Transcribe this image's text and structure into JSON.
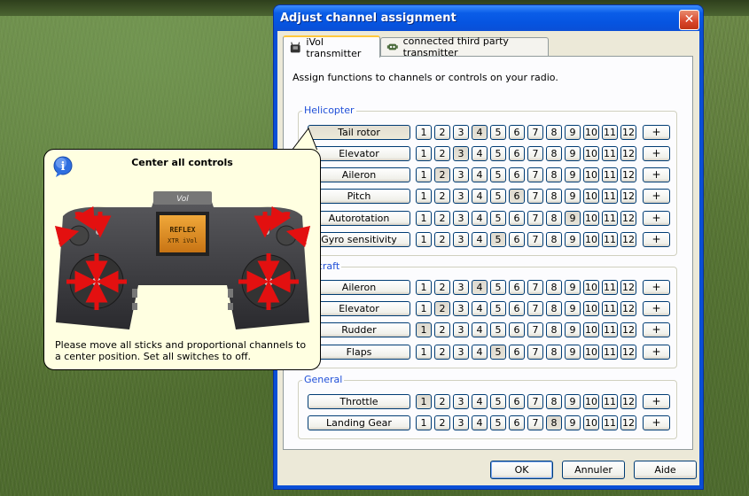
{
  "dialog": {
    "title": "Adjust channel assignment",
    "close_label": "✕",
    "tabs": [
      {
        "label": "iVol transmitter",
        "icon": "transmitter-icon"
      },
      {
        "label": "connected third party transmitter",
        "icon": "robot-icon"
      }
    ],
    "intro": "Assign functions to channels or controls on your radio.",
    "groups": [
      {
        "label": "Helicopter",
        "rows": [
          {
            "label": "Tail rotor",
            "selected": 4
          },
          {
            "label": "Elevator",
            "selected": 3
          },
          {
            "label": "Aileron",
            "selected": 2
          },
          {
            "label": "Pitch",
            "selected": 6
          },
          {
            "label": "Autorotation",
            "selected": 9
          },
          {
            "label": "Gyro sensitivity",
            "selected": 5
          }
        ]
      },
      {
        "label": "Aircraft",
        "rows": [
          {
            "label": "Aileron",
            "selected": 4
          },
          {
            "label": "Elevator",
            "selected": 2
          },
          {
            "label": "Rudder",
            "selected": 1
          },
          {
            "label": "Flaps",
            "selected": 5
          }
        ]
      },
      {
        "label": "General",
        "rows": [
          {
            "label": "Throttle",
            "selected": 1
          },
          {
            "label": "Landing Gear",
            "selected": 8
          }
        ]
      }
    ],
    "channels": [
      "1",
      "2",
      "3",
      "4",
      "5",
      "6",
      "7",
      "8",
      "9",
      "10",
      "11",
      "12"
    ],
    "plus_label": "+",
    "buttons": {
      "ok": "OK",
      "cancel": "Annuler",
      "help": "Aide"
    }
  },
  "tooltip": {
    "title": "Center all controls",
    "screen_line1": "REFLEX",
    "screen_line2": "XTR iVol",
    "message": "Please move all sticks and proportional channels to a center position. Set all switches to off."
  }
}
